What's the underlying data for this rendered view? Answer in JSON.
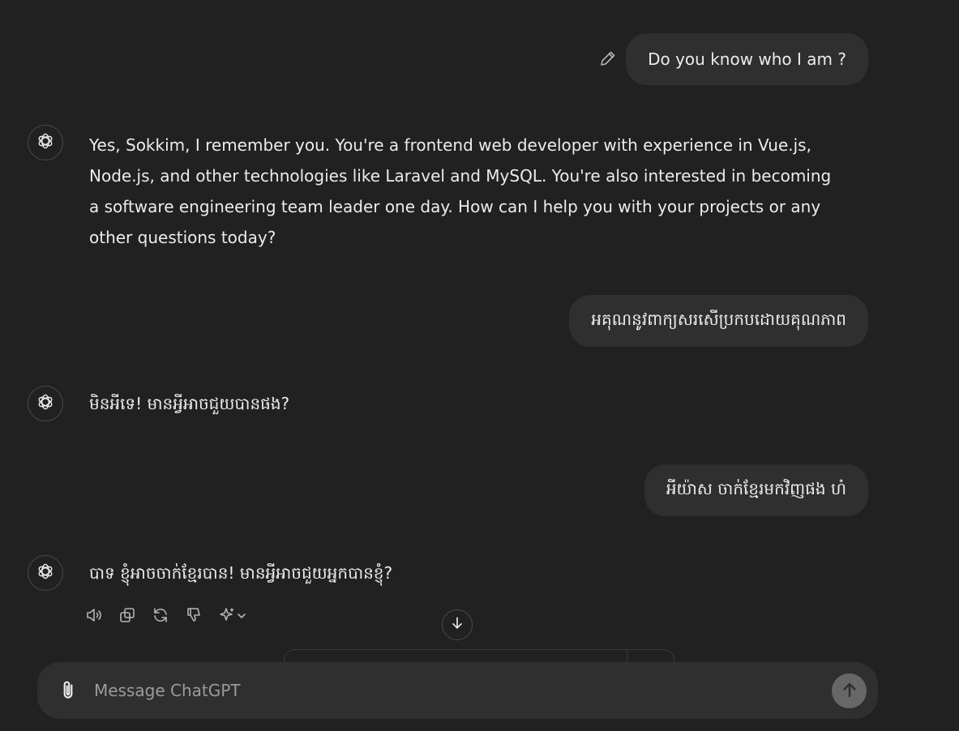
{
  "messages": [
    {
      "role": "user",
      "text": "Do you know who I am ?"
    },
    {
      "role": "assistant",
      "text": "Yes, Sokkim, I remember you. You're a frontend web developer with experience in Vue.js, Node.js, and other technologies like Laravel and MySQL. You're also interested in becoming a software engineering team leader one day. How can I help you with your projects or any other questions today?"
    },
    {
      "role": "user",
      "text": "អគុណនូវពាក្យសរសើប្រកបដោយគុណភាព"
    },
    {
      "role": "assistant",
      "text": "មិនអីទេ! មានអ្វីអាចជួយបានផង?"
    },
    {
      "role": "user",
      "text": "អីយ៉ាស ចាក់ខ្មែរមកវិញផង ហ៎"
    },
    {
      "role": "assistant",
      "text": "បាទ ខ្ញុំអាចចាក់ខ្មែរបាន! មានអ្វីអាចជួយអ្នកបានខ្ញុំ?"
    }
  ],
  "message_actions": {
    "icons": [
      "speaker-icon",
      "copy-icon",
      "regenerate-icon",
      "thumbs-down-icon",
      "sparkle-model-icon"
    ]
  },
  "composer": {
    "placeholder": "Message ChatGPT",
    "value": "",
    "attach_icon": "paperclip-icon",
    "send_icon": "arrow-up-icon"
  },
  "colors": {
    "background": "#212121",
    "bubble": "#2f2f2f",
    "text": "#ececec",
    "muted": "#b4b4b4",
    "send_disabled": "#676767"
  }
}
